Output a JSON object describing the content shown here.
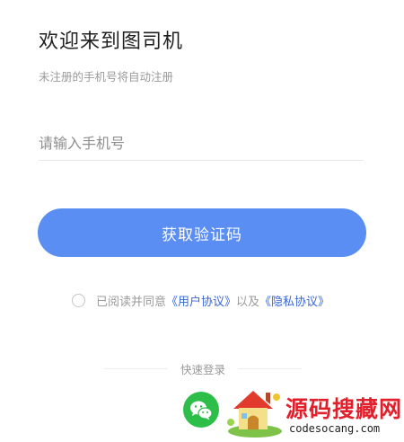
{
  "header": {
    "title": "欢迎来到图司机",
    "subtitle": "未注册的手机号将自动注册"
  },
  "form": {
    "phone_placeholder": "请输入手机号",
    "phone_value": "",
    "get_code_label": "获取验证码"
  },
  "agreement": {
    "checked": false,
    "prefix": "已阅读并同意",
    "user_agreement": "《用户协议》",
    "connector": "以及",
    "privacy_policy": "《隐私协议》"
  },
  "quick_login": {
    "label": "快速登录",
    "options": [
      {
        "icon": "wechat-icon"
      }
    ]
  },
  "watermark": {
    "title": "源码搜藏网",
    "url": "codesocang.com"
  },
  "colors": {
    "primary": "#5a8ef2",
    "link": "#3a68d6",
    "wechat": "#2dbe4a",
    "watermark": "#e21f2a"
  }
}
